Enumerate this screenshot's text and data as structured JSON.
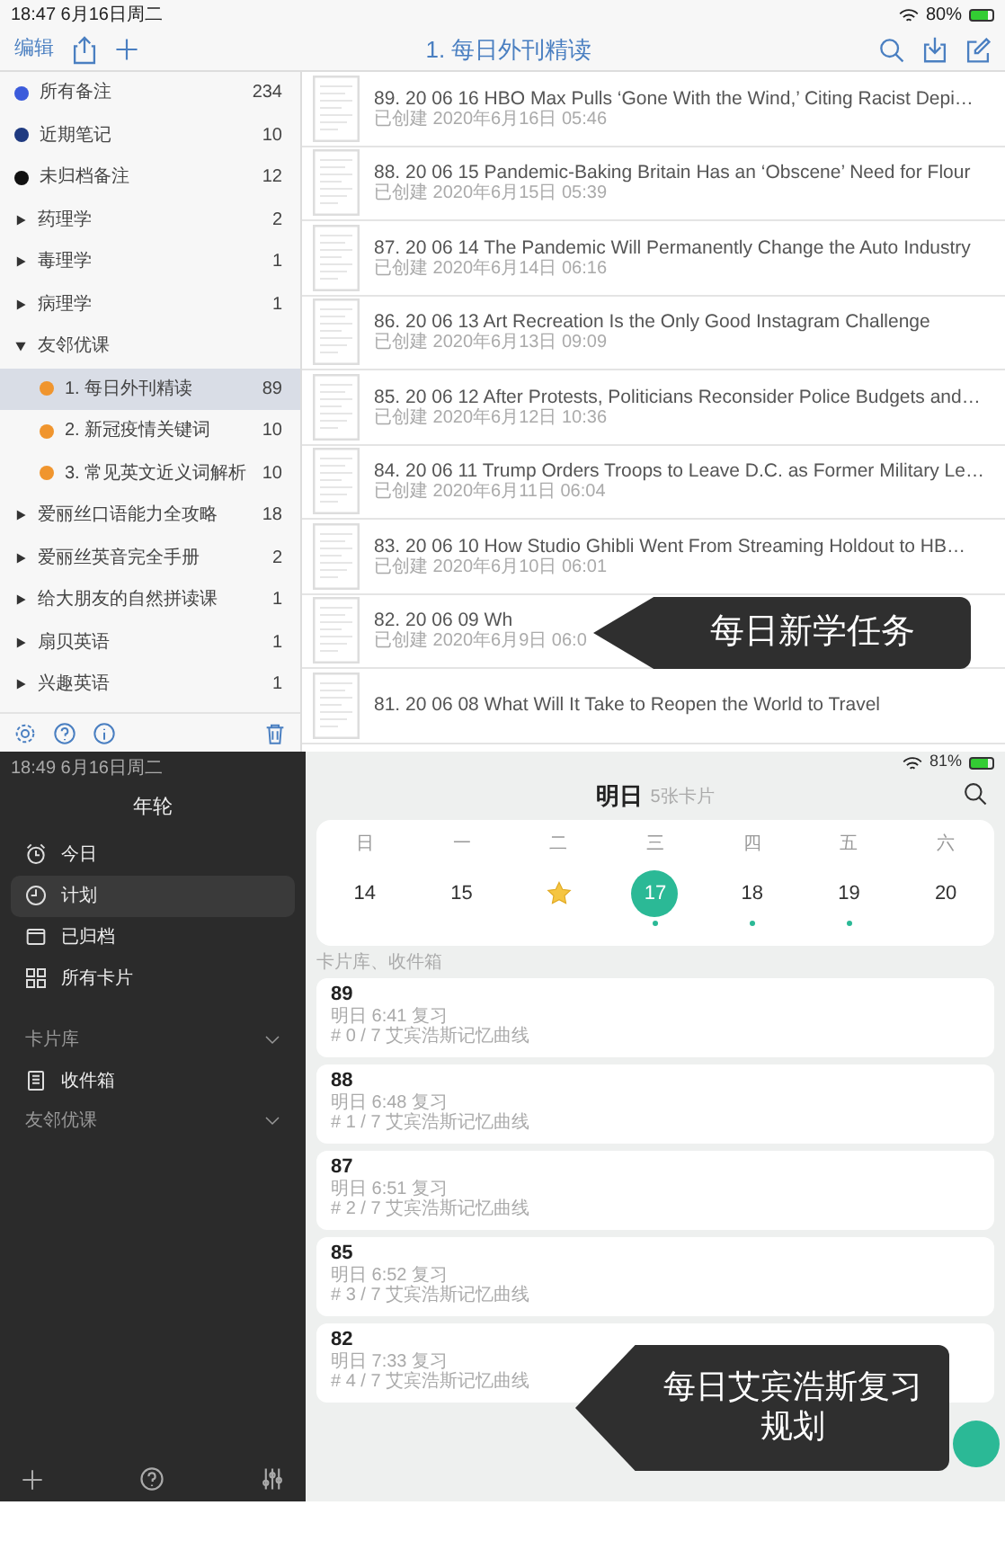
{
  "top": {
    "status_bar": {
      "time": "18:47",
      "date": "6月16日周二",
      "battery": "80%"
    },
    "toolbar": {
      "edit": "编辑",
      "title": "1. 每日外刊精读"
    },
    "sidebar": {
      "items": [
        {
          "kind": "dot",
          "label": "所有备注",
          "count": "234",
          "color": "#3b5bdb",
          "selected": false
        },
        {
          "kind": "dot",
          "label": "近期笔记",
          "count": "10",
          "color": "#1f3a80",
          "selected": false
        },
        {
          "kind": "dot",
          "label": "未归档备注",
          "count": "12",
          "color": "#111111",
          "selected": false
        },
        {
          "kind": "folder",
          "label": "药理学",
          "count": "2",
          "expanded": false,
          "selected": false
        },
        {
          "kind": "folder",
          "label": "毒理学",
          "count": "1",
          "expanded": false,
          "selected": false
        },
        {
          "kind": "folder",
          "label": "病理学",
          "count": "1",
          "expanded": false,
          "selected": false
        },
        {
          "kind": "folder",
          "label": "友邻优课",
          "expanded": true,
          "selected": false,
          "children": [
            {
              "kind": "dot",
              "label": "1. 每日外刊精读",
              "count": "89",
              "color": "#f0952e",
              "selected": true
            },
            {
              "kind": "dot",
              "label": "2. 新冠疫情关键词",
              "count": "10",
              "color": "#f0952e",
              "selected": false
            },
            {
              "kind": "dot",
              "label": "3. 常见英文近义词解析",
              "count": "10",
              "color": "#f0952e",
              "selected": false
            }
          ]
        },
        {
          "kind": "folder",
          "label": "爱丽丝口语能力全攻略",
          "count": "18",
          "expanded": false,
          "selected": false
        },
        {
          "kind": "folder",
          "label": "爱丽丝英音完全手册",
          "count": "2",
          "expanded": false,
          "selected": false
        },
        {
          "kind": "folder",
          "label": "给大朋友的自然拼读课",
          "count": "1",
          "expanded": false,
          "selected": false
        },
        {
          "kind": "folder",
          "label": "扇贝英语",
          "count": "1",
          "expanded": false,
          "selected": false
        },
        {
          "kind": "folder",
          "label": "兴趣英语",
          "count": "1",
          "expanded": false,
          "selected": false
        }
      ]
    },
    "notes": [
      {
        "number": "89.",
        "title": "20 06 16 HBO Max Pulls ‘Gone With the Wind,’ Citing Racist Depi…",
        "date": "已创建 2020年6月16日 05:46"
      },
      {
        "number": "88.",
        "title": "20 06 15 Pandemic-Baking Britain Has an ‘Obscene’ Need for Flour",
        "date": "已创建 2020年6月15日 05:39"
      },
      {
        "number": "87.",
        "title": "20 06 14 The Pandemic Will Permanently Change the Auto Industry",
        "date": "已创建 2020年6月14日 06:16"
      },
      {
        "number": "86.",
        "title": "20 06 13 Art Recreation Is the Only Good Instagram Challenge",
        "date": "已创建 2020年6月13日 09:09"
      },
      {
        "number": "85.",
        "title": "20 06 12 After Protests, Politicians Reconsider Police Budgets and…",
        "date": "已创建 2020年6月12日 10:36"
      },
      {
        "number": "84.",
        "title": "20 06 11 Trump Orders Troops to Leave D.C. as Former Military Le…",
        "date": "已创建 2020年6月11日 06:04"
      },
      {
        "number": "83.",
        "title": "20 06 10 How Studio Ghibli Went From Streaming Holdout to HB…",
        "date": "已创建 2020年6月10日 06:01"
      },
      {
        "number": "82.",
        "title": "20 06 09 Wh",
        "date": "已创建 2020年6月9日 06:0"
      },
      {
        "number": "81.",
        "title": "20 06 08 What Will It Take to Reopen the World to Travel"
      }
    ],
    "callout": "每日新学任务"
  },
  "bottom": {
    "status_bar": {
      "time": "18:49",
      "date": "6月16日周二",
      "battery": "81%"
    },
    "sidebar": {
      "title": "年轮",
      "nav": [
        {
          "kind": "alarm",
          "label": "今日",
          "selected": false
        },
        {
          "kind": "clock",
          "label": "计划",
          "selected": true
        },
        {
          "kind": "archive",
          "label": "已归档",
          "selected": false
        },
        {
          "kind": "grid",
          "label": "所有卡片",
          "selected": false
        }
      ],
      "sections": [
        {
          "label": "卡片库",
          "expanded": true,
          "items": [
            {
              "label": "收件箱"
            }
          ]
        },
        {
          "label": "友邻优课",
          "expanded": true
        }
      ]
    },
    "header": {
      "title": "明日",
      "subtitle": "5张卡片"
    },
    "calendar": {
      "weekdays": [
        "日",
        "一",
        "二",
        "三",
        "四",
        "五",
        "六"
      ],
      "days": [
        {
          "kind": "date",
          "label": "14",
          "selected": false,
          "dot": false
        },
        {
          "kind": "date",
          "label": "15",
          "selected": false,
          "dot": false
        },
        {
          "kind": "star",
          "selected": false,
          "dot": false
        },
        {
          "kind": "date",
          "label": "17",
          "selected": true,
          "dot": true
        },
        {
          "kind": "date",
          "label": "18",
          "selected": false,
          "dot": true
        },
        {
          "kind": "date",
          "label": "19",
          "selected": false,
          "dot": true
        },
        {
          "kind": "date",
          "label": "20",
          "selected": false,
          "dot": false
        }
      ]
    },
    "breadcrumb": "卡片库、收件箱",
    "cards": [
      {
        "title": "89",
        "time": "明日 6:41 复习",
        "progress": "# 0 / 7 艾宾浩斯记忆曲线"
      },
      {
        "title": "88",
        "time": "明日 6:48 复习",
        "progress": "# 1 / 7 艾宾浩斯记忆曲线"
      },
      {
        "title": "87",
        "time": "明日 6:51 复习",
        "progress": "# 2 / 7 艾宾浩斯记忆曲线"
      },
      {
        "title": "85",
        "time": "明日 6:52 复习",
        "progress": "# 3 / 7 艾宾浩斯记忆曲线"
      },
      {
        "title": "82",
        "time": "明日 7:33 复习",
        "progress": "# 4 / 7 艾宾浩斯记忆曲线"
      }
    ],
    "callout": "每日艾宾浩斯复习规划"
  }
}
